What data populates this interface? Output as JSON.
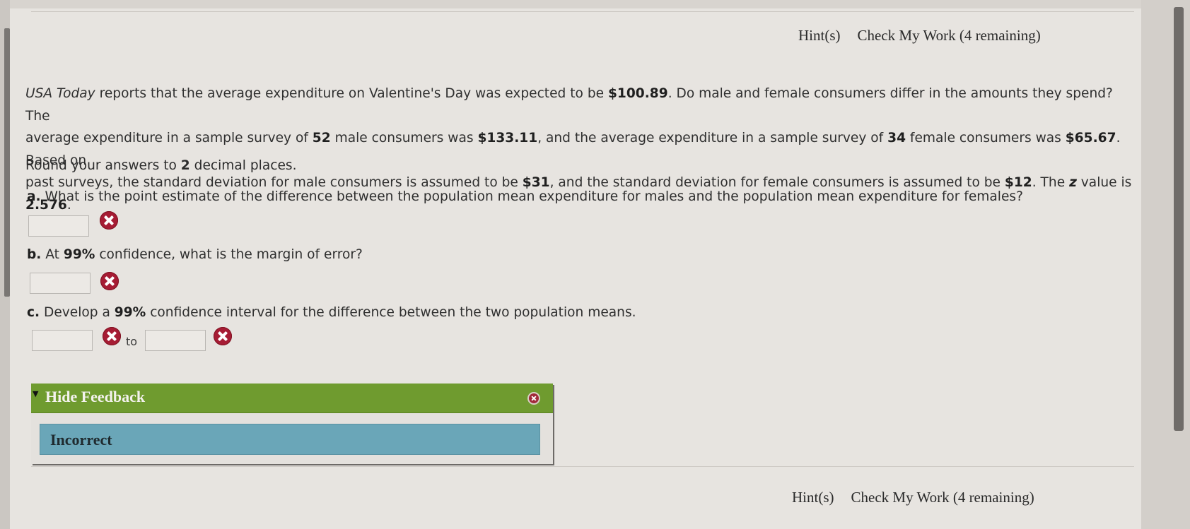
{
  "header": {
    "hints_label": "Hint(s)",
    "check_label": "Check My Work (4 remaining)"
  },
  "problem": {
    "line1": {
      "source": "USA Today",
      "t1": " reports that the average expenditure on Valentine's Day was expected to be ",
      "v1": "$100.89",
      "t2": ". Do male and female consumers differ in the amounts they spend? The"
    },
    "line2": {
      "t1": "average expenditure in a sample survey of ",
      "v1": "52",
      "t2": " male consumers was ",
      "v2": "$133.11",
      "t3": ", and the average expenditure in a sample survey of ",
      "v3": "34",
      "t4": " female consumers was ",
      "v4": "$65.67",
      "t5": ". Based on"
    },
    "line3": {
      "t1": "past surveys, the standard deviation for male consumers is assumed to be ",
      "v1": "$31",
      "t2": ", and the standard deviation for female consumers is assumed to be ",
      "v2": "$12",
      "t3": ". The ",
      "z": "z",
      "t4": " value is ",
      "v3": "2.576",
      "t5": "."
    }
  },
  "rounding": {
    "t1": "Round your answers to ",
    "v1": "2",
    "t2": " decimal places."
  },
  "questions": {
    "a": {
      "letter": "a.",
      "text": " What is the point estimate of the difference between the population mean expenditure for males and the population mean expenditure for females?",
      "answer": ""
    },
    "b": {
      "letter": "b.",
      "t1": " At ",
      "v1": "99%",
      "t2": " confidence, what is the margin of error?",
      "answer": ""
    },
    "c": {
      "letter": "c.",
      "t1": " Develop a ",
      "v1": "99%",
      "t2": " confidence interval for the difference between the two population means.",
      "lower": "",
      "upper": "",
      "to_label": "to"
    }
  },
  "feedback": {
    "toggle_icon": "▼",
    "title": "Hide Feedback",
    "result": "Incorrect"
  },
  "footer": {
    "hints_label": "Hint(s)",
    "check_label": "Check My Work (4 remaining)"
  },
  "colors": {
    "feedback_header": "#6f9b2f",
    "feedback_body": "#6aa6b8",
    "incorrect_icon": "#a61c34"
  }
}
